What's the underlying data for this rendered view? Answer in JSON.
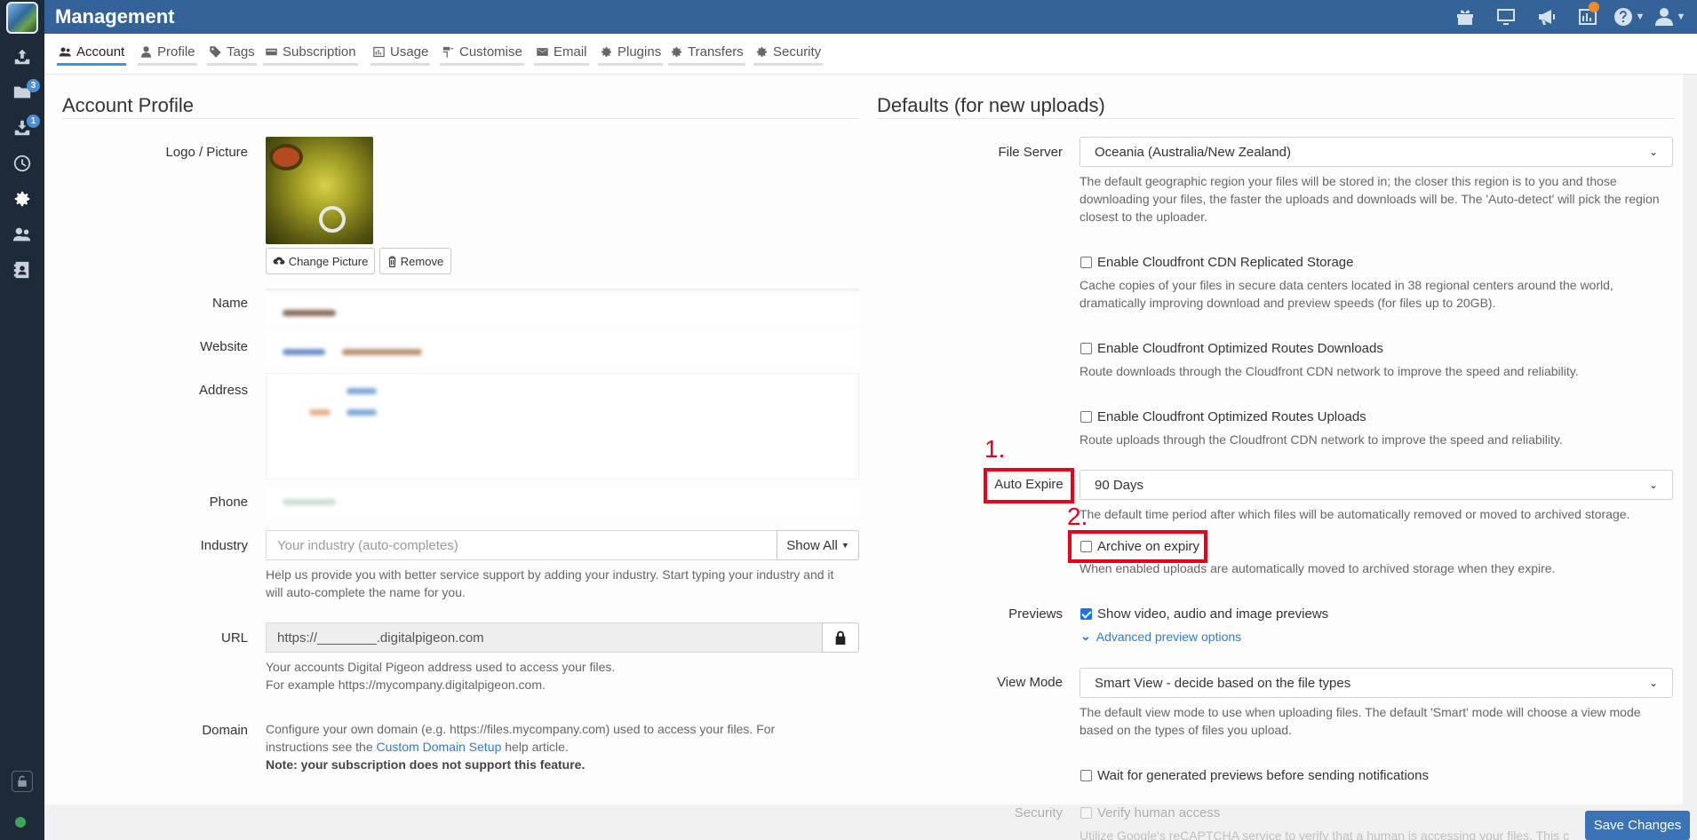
{
  "header": {
    "title": "Management",
    "icons": [
      "gift-icon",
      "monitor-icon",
      "megaphone-icon",
      "chart-icon",
      "help-icon",
      "user-icon"
    ]
  },
  "sidebar": {
    "items": [
      {
        "icon": "upload-icon",
        "badge": ""
      },
      {
        "icon": "folder-icon",
        "badge": "3"
      },
      {
        "icon": "download-icon",
        "badge": "1"
      },
      {
        "icon": "clock-icon",
        "badge": ""
      },
      {
        "icon": "gear-icon",
        "badge": ""
      },
      {
        "icon": "users-icon",
        "badge": ""
      },
      {
        "icon": "contacts-icon",
        "badge": ""
      }
    ]
  },
  "tabs": [
    {
      "label": "Account",
      "icon": "account-icon",
      "active": true
    },
    {
      "label": "Profile",
      "icon": "profile-icon"
    },
    {
      "label": "Tags",
      "icon": "tag-icon"
    },
    {
      "label": "Subscription",
      "icon": "subscription-icon"
    },
    {
      "label": "Usage",
      "icon": "usage-icon"
    },
    {
      "label": "Customise",
      "icon": "customise-icon"
    },
    {
      "label": "Email",
      "icon": "email-icon"
    },
    {
      "label": "Plugins",
      "icon": "gear-icon"
    },
    {
      "label": "Transfers",
      "icon": "gear-icon"
    },
    {
      "label": "Security",
      "icon": "gear-icon"
    }
  ],
  "account_profile": {
    "title": "Account Profile",
    "logo_label": "Logo / Picture",
    "change_picture": "Change Picture",
    "remove": "Remove",
    "name_label": "Name",
    "website_label": "Website",
    "address_label": "Address",
    "phone_label": "Phone",
    "industry_label": "Industry",
    "industry_placeholder": "Your industry (auto-completes)",
    "show_all": "Show All",
    "industry_help": "Help us provide you with better service support by adding your industry. Start typing your industry and it will auto-complete the name for you.",
    "url_label": "URL",
    "url_value": "https://________.digitalpigeon.com",
    "url_help_1": "Your accounts Digital Pigeon address used to access your files.",
    "url_help_2": "For example https://mycompany.digitalpigeon.com.",
    "domain_label": "Domain",
    "domain_help_1": "Configure your own domain (e.g. https://files.mycompany.com) used to access your files. For instructions see the",
    "domain_link": "Custom Domain Setup",
    "domain_help_2": "help article.",
    "domain_note": "Note: your subscription does not support this feature."
  },
  "defaults": {
    "title": "Defaults (for new uploads)",
    "file_server_label": "File Server",
    "file_server_value": "Oceania (Australia/New Zealand)",
    "file_server_help": "The default geographic region your files will be stored in; the closer this region is to you and those downloading your files, the faster the uploads and downloads will be. The 'Auto-detect' will pick the region closest to the uploader.",
    "cdn_label": "Enable Cloudfront CDN Replicated Storage",
    "cdn_help": "Cache copies of your files in secure data centers located in 38 regional centers around the world, dramatically improving download and preview speeds (for files up to 20GB).",
    "routes_dl_label": "Enable Cloudfront Optimized Routes Downloads",
    "routes_dl_help": "Route downloads through the Cloudfront CDN network to improve the speed and reliability.",
    "routes_ul_label": "Enable Cloudfront Optimized Routes Uploads",
    "routes_ul_help": "Route uploads through the Cloudfront CDN network to improve the speed and reliability.",
    "auto_expire_label": "Auto Expire",
    "auto_expire_value": "90 Days",
    "auto_expire_help": "The default time period after which files will be automatically removed or moved to archived storage.",
    "archive_label": "Archive on expiry",
    "archive_help": "When enabled uploads are automatically moved to archived storage when they expire.",
    "previews_label": "Previews",
    "previews_check": "Show video, audio and image previews",
    "advanced_previews": "Advanced preview options",
    "view_mode_label": "View Mode",
    "view_mode_value": "Smart View - decide based on the file types",
    "view_mode_help": "The default view mode to use when uploading files. The default 'Smart' mode will choose a view mode based on the types of files you upload.",
    "wait_previews": "Wait for generated previews before sending notifications",
    "security_label": "Security",
    "verify_human": "Verify human access",
    "security_help": "Utilize Google's reCAPTCHA service to verify that a human is accessing your files. This c"
  },
  "annotations": {
    "one": "1.",
    "two": "2."
  },
  "save_changes": "Save Changes"
}
